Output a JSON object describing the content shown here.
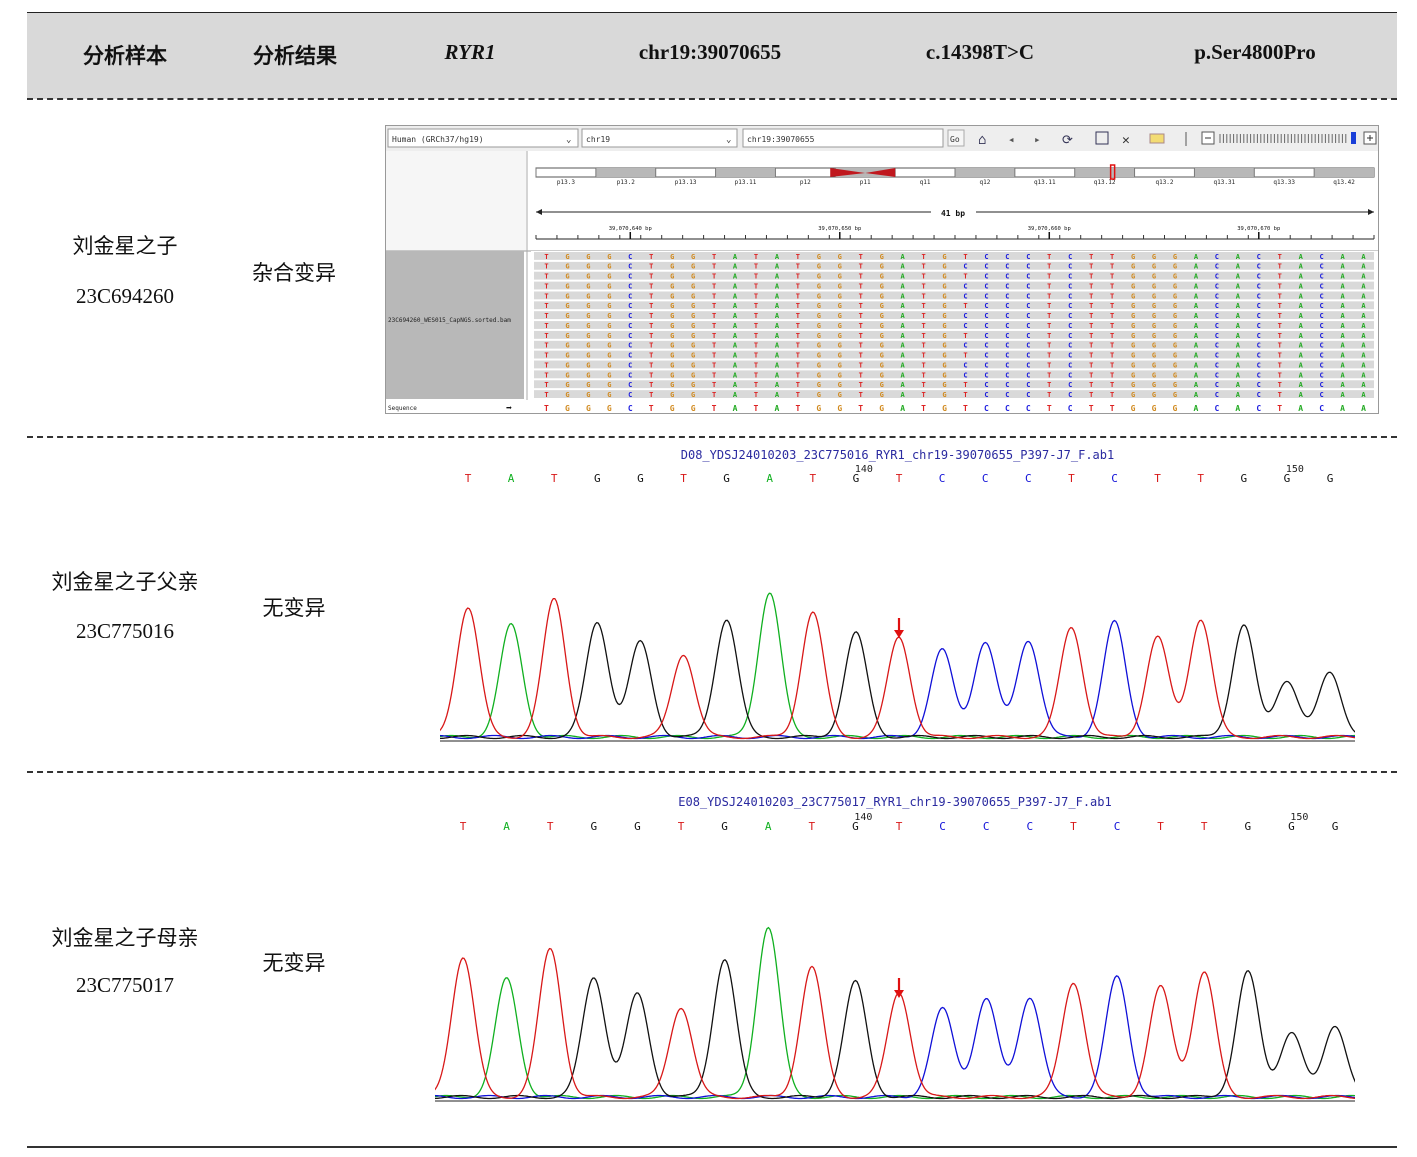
{
  "header": {
    "col_sample": "分析样本",
    "col_result": "分析结果",
    "gene": "RYR1",
    "position": "chr19:39070655",
    "cdna": "c.14398T>C",
    "protein": "p.Ser4800Pro"
  },
  "rows": [
    {
      "name": "刘金星之子",
      "id": "23C694260",
      "result": "杂合变异"
    },
    {
      "name": "刘金星之子父亲",
      "id": "23C775016",
      "result": "无变异"
    },
    {
      "name": "刘金星之子母亲",
      "id": "23C775017",
      "result": "无变异"
    }
  ],
  "igv": {
    "genome": "Human (GRCh37/hg19)",
    "chrom": "chr19",
    "locus": "chr19:39070655",
    "go": "Go",
    "bands": [
      "p13.3",
      "p13.2",
      "p13.13",
      "p13.11",
      "p12",
      "p11",
      "q11",
      "q12",
      "q13.11",
      "q13.12",
      "q13.2",
      "q13.31",
      "q13.33",
      "q13.42"
    ],
    "span": "41 bp",
    "ticks": [
      "39,070,640 bp",
      "39,070,650 bp",
      "39,070,660 bp",
      "39,070,670 bp"
    ],
    "track": "23C694260_WES015_CapNGS.sorted.bam",
    "sequence_label": "Sequence",
    "sequence": "TGGGCTGGTATATGGTGATGTCCCTCTTGGGACACTACAA",
    "variant_column": 20,
    "variant_read_fraction": 0.5,
    "colors": {
      "A": "#22aa22",
      "C": "#1a1adf",
      "G": "#d18a1f",
      "T": "#dd2222"
    }
  },
  "chromatograms": [
    {
      "title": "D08_YDSJ24010203_23C775016_RYR1_chr19-39070655_P397-J7_F.ab1",
      "bases": "TATGGTGATGTCCCTCTTGGG",
      "pos_labels": [
        {
          "index": 9,
          "text": "140"
        },
        {
          "index": 19,
          "text": "150"
        }
      ],
      "variant_index": 10
    },
    {
      "title": "E08_YDSJ24010203_23C775017_RYR1_chr19-39070655_P397-J7_F.ab1",
      "bases": "TATGGTGATGTCCCTCTTGGG",
      "pos_labels": [
        {
          "index": 9,
          "text": "140"
        },
        {
          "index": 19,
          "text": "150"
        }
      ],
      "variant_index": 10
    }
  ],
  "trace_colors": {
    "A": "#10b020",
    "C": "#1010d8",
    "G": "#111111",
    "T": "#d81818"
  }
}
